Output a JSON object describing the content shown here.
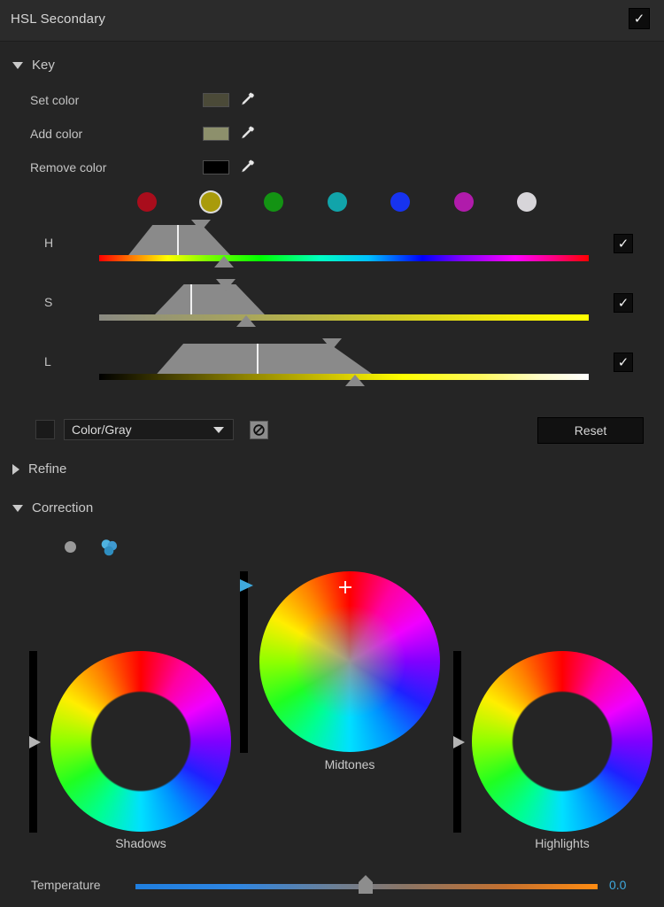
{
  "header": {
    "title": "HSL Secondary",
    "enabled_checkbox": "✓"
  },
  "sections": {
    "key": {
      "label": "Key",
      "expanded": true,
      "arrow": "triangle-down-icon"
    },
    "refine": {
      "label": "Refine",
      "expanded": false,
      "arrow": "triangle-right-icon"
    },
    "correction": {
      "label": "Correction",
      "expanded": true,
      "arrow": "triangle-down-icon"
    }
  },
  "key": {
    "rows": [
      {
        "label": "Set color",
        "swatch_color": "#4b4a38",
        "picker_icon": "eyedropper-icon"
      },
      {
        "label": "Add color",
        "swatch_color": "#8d906c",
        "picker_icon": "eyedropper-icon"
      },
      {
        "label": "Remove color",
        "swatch_color": "#000000",
        "picker_icon": "eyedropper-icon"
      }
    ],
    "preset_dots": [
      {
        "name": "red",
        "color": "#a90d1c",
        "selected": false
      },
      {
        "name": "yellow",
        "color": "#a99b0b",
        "selected": true
      },
      {
        "name": "green",
        "color": "#139313",
        "selected": false
      },
      {
        "name": "cyan",
        "color": "#11a4aa",
        "selected": false
      },
      {
        "name": "blue",
        "color": "#1733ef",
        "selected": false
      },
      {
        "name": "magenta",
        "color": "#b01bab",
        "selected": false
      },
      {
        "name": "white",
        "color": "#d7d5d9",
        "selected": false
      }
    ],
    "qualifiers": [
      {
        "label": "H",
        "enabled": true,
        "checkmark": "✓",
        "bar_type": "hue-spectrum",
        "range": {
          "low_outer_pct": 6.0,
          "low_inner_pct": 10.9,
          "high_inner_pct": 21.0,
          "high_outer_pct": 26.8
        },
        "center_pct": 15.9,
        "top_handle_pct": 20.8,
        "bottom_handle_pct": 25.5
      },
      {
        "label": "S",
        "enabled": true,
        "checkmark": "✓",
        "bar_type": "saturation-gray-to-yellow",
        "range": {
          "low_outer_pct": 11.4,
          "low_inner_pct": 17.3,
          "high_inner_pct": 27.9,
          "high_outer_pct": 33.8
        },
        "center_pct": 18.6,
        "top_handle_pct": 25.9,
        "bottom_handle_pct": 30.0
      },
      {
        "label": "L",
        "enabled": true,
        "checkmark": "✓",
        "bar_type": "luma-black-yellow-white",
        "range": {
          "low_outer_pct": 11.8,
          "low_inner_pct": 17.2,
          "high_inner_pct": 47.0,
          "high_outer_pct": 55.7
        },
        "center_pct": 32.2,
        "top_handle_pct": 47.5,
        "bottom_handle_pct": 52.2
      }
    ],
    "output_swatch_color": "#1a1a1a",
    "mode_dropdown": {
      "value": "Color/Gray",
      "arrow_icon": "chevron-down-icon"
    },
    "invert_button": {
      "icon": "null-slash-icon"
    },
    "reset_button": {
      "label": "Reset"
    }
  },
  "correction": {
    "mode_buttons": [
      {
        "name": "single-wheel-mode",
        "icon": "circle-icon",
        "selected": false
      },
      {
        "name": "three-wheel-mode",
        "icon": "three-circles-icon",
        "selected": true,
        "color": "#45a8d8"
      }
    ],
    "wheels": [
      {
        "label": "Shadows",
        "type": "ring",
        "slider_handle_color": "#b4b4b4",
        "slider_handle_pct": 50
      },
      {
        "label": "Midtones",
        "type": "disc",
        "slider_handle_color": "#3fa9dd",
        "slider_handle_pct": 8,
        "cursor_icon": "crosshair-icon"
      },
      {
        "label": "Highlights",
        "type": "ring",
        "slider_handle_color": "#b4b4b4",
        "slider_handle_pct": 50
      }
    ],
    "temperature": {
      "label": "Temperature",
      "value": "0.0",
      "value_color": "#3fa9dd",
      "handle_pct": 50
    }
  }
}
